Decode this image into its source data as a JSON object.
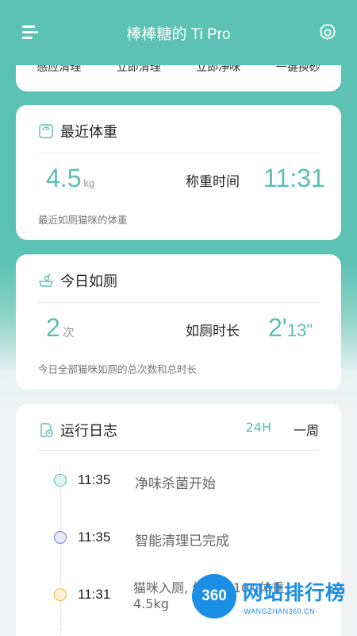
{
  "header": {
    "title": "棒棒糖的 Ti Pro",
    "menu_icon": "menu-icon",
    "settings_icon": "gear-icon"
  },
  "actions": [
    {
      "label": "感应清理"
    },
    {
      "label": "立即清理"
    },
    {
      "label": "立即净味"
    },
    {
      "label": "一键换砂"
    }
  ],
  "weight_card": {
    "title": "最近体重",
    "icon": "scale-icon",
    "value": "4.5",
    "unit": "kg",
    "time_label": "称重时间",
    "time_value": "11:31",
    "caption": "最近如厕猫咪的体重"
  },
  "toilet_card": {
    "title": "今日如厕",
    "icon": "toilet-icon",
    "count": "2",
    "count_unit": "次",
    "duration_label": "如厕时长",
    "duration_min": "2'",
    "duration_sec": "13\"",
    "caption": "今日全部猫咪如厕的总次数和总时长"
  },
  "log_card": {
    "title": "运行日志",
    "icon": "log-icon",
    "tabs": [
      {
        "label": "24H",
        "active": true
      },
      {
        "label": "一周",
        "active": false
      }
    ],
    "entries": [
      {
        "time": "11:35",
        "text": "净味杀菌开始",
        "icon": "leaf-icon",
        "color": "#5bbfb1"
      },
      {
        "time": "11:35",
        "text": "智能清理已完成",
        "icon": "clean-icon",
        "color": "#6c7bd6"
      },
      {
        "time": "11:31",
        "text": "猫咪入厕, 停留 1'10\",体重",
        "text2": "4.5kg",
        "icon": "cat-icon",
        "color": "#f5b335"
      }
    ]
  },
  "watermark": {
    "badge": "360",
    "text": "网站排行榜",
    "sub": "-WANGZHAN360.CN-"
  },
  "colors": {
    "accent": "#5bbfb1",
    "header_bg": "#5bc2b4"
  }
}
